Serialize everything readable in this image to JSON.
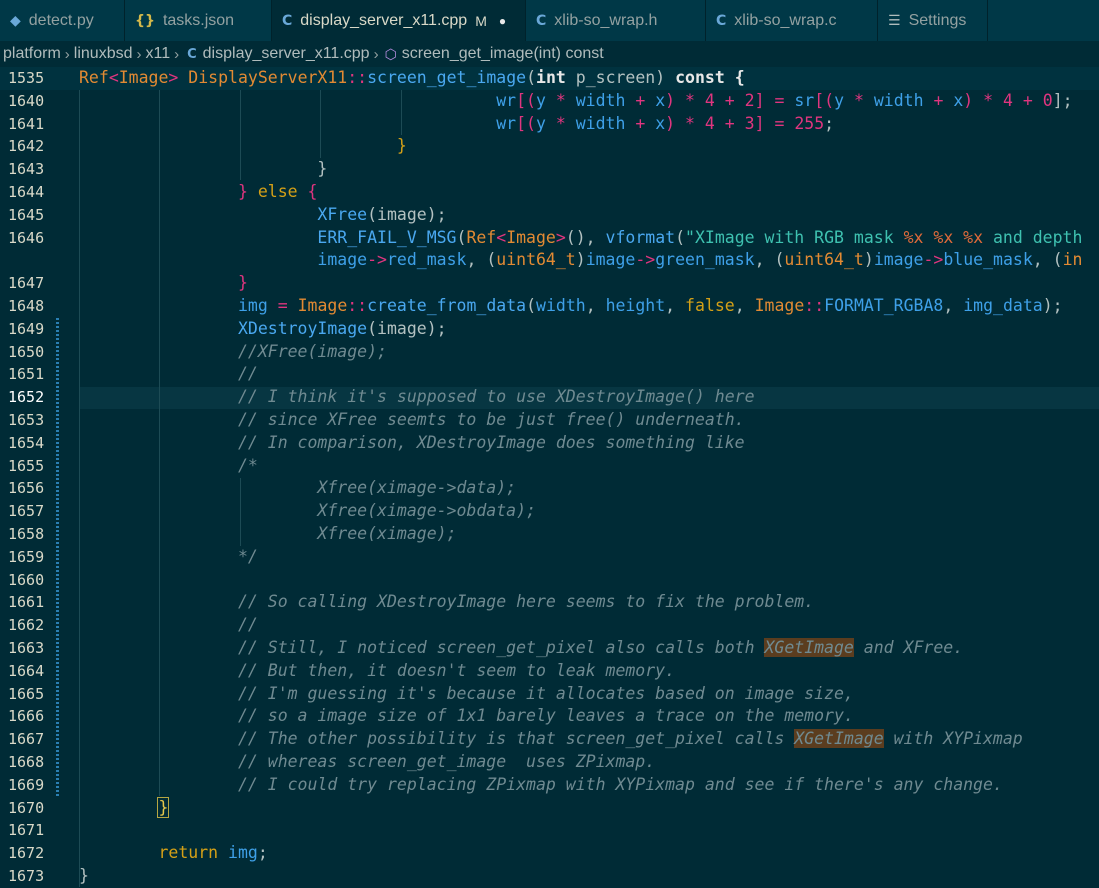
{
  "tabs": [
    {
      "label": "detect.py",
      "icon": "python-icon",
      "mod": "",
      "active": false
    },
    {
      "label": "tasks.json",
      "icon": "json-icon",
      "mod": "",
      "active": false
    },
    {
      "label": "display_server_x11.cpp",
      "icon": "cpp-icon",
      "mod": "M",
      "active": true
    },
    {
      "label": "xlib-so_wrap.h",
      "icon": "c-icon",
      "mod": "",
      "active": false
    },
    {
      "label": "xlib-so_wrap.c",
      "icon": "c-icon",
      "mod": "",
      "active": false
    },
    {
      "label": "Settings",
      "icon": "settings-icon",
      "mod": "",
      "active": false
    }
  ],
  "breadcrumb": [
    "platform",
    "linuxbsd",
    "x11",
    "display_server_x11.cpp",
    "screen_get_image(int) const"
  ],
  "colors": {
    "background": "#002b36",
    "comment": "#6f8a91",
    "highlight": "#5b3d1f"
  },
  "lines": [
    {
      "n": "1535",
      "s": [
        [
          "Ref",
          "t-orange"
        ],
        [
          "<",
          "t-pink"
        ],
        [
          "Image",
          "t-orange"
        ],
        [
          "> ",
          "t-pink"
        ],
        [
          "DisplayServerX11",
          "t-orange"
        ],
        [
          "::",
          "t-pink"
        ],
        [
          "screen_get_image",
          "t-fn"
        ],
        [
          "(",
          "t-plain"
        ],
        [
          "int",
          "t-white"
        ],
        [
          " p_screen) ",
          "t-plain"
        ],
        [
          "const",
          "t-white"
        ],
        [
          " {",
          "t-white"
        ]
      ]
    },
    {
      "n": "1640",
      "s": [
        [
          "                                          ",
          ""
        ],
        [
          "wr",
          "t-blue"
        ],
        [
          "[(",
          "t-pink"
        ],
        [
          "y",
          "t-blue"
        ],
        [
          " * ",
          "t-pink"
        ],
        [
          "width",
          "t-blue"
        ],
        [
          " + ",
          "t-pink"
        ],
        [
          "x",
          "t-blue"
        ],
        [
          ") * ",
          "t-pink"
        ],
        [
          "4",
          "t-pink"
        ],
        [
          " + ",
          "t-pink"
        ],
        [
          "2",
          "t-pink"
        ],
        [
          "] = ",
          "t-pink"
        ],
        [
          "sr",
          "t-blue"
        ],
        [
          "[(",
          "t-pink"
        ],
        [
          "y",
          "t-blue"
        ],
        [
          " * ",
          "t-pink"
        ],
        [
          "width",
          "t-blue"
        ],
        [
          " + ",
          "t-pink"
        ],
        [
          "x",
          "t-blue"
        ],
        [
          ") * ",
          "t-pink"
        ],
        [
          "4",
          "t-pink"
        ],
        [
          " + ",
          "t-pink"
        ],
        [
          "0",
          "t-pink"
        ],
        [
          "];",
          "t-plain"
        ]
      ]
    },
    {
      "n": "1641",
      "s": [
        [
          "                                          ",
          ""
        ],
        [
          "wr",
          "t-blue"
        ],
        [
          "[(",
          "t-pink"
        ],
        [
          "y",
          "t-blue"
        ],
        [
          " * ",
          "t-pink"
        ],
        [
          "width",
          "t-blue"
        ],
        [
          " + ",
          "t-pink"
        ],
        [
          "x",
          "t-blue"
        ],
        [
          ") * ",
          "t-pink"
        ],
        [
          "4",
          "t-pink"
        ],
        [
          " + ",
          "t-pink"
        ],
        [
          "3",
          "t-pink"
        ],
        [
          "] = ",
          "t-pink"
        ],
        [
          "255",
          "t-pink"
        ],
        [
          ";",
          "t-plain"
        ]
      ]
    },
    {
      "n": "1642",
      "s": [
        [
          "                                ",
          ""
        ],
        [
          "}",
          "t-yellow"
        ]
      ]
    },
    {
      "n": "1643",
      "s": [
        [
          "                        ",
          ""
        ],
        [
          "}",
          "t-plain"
        ]
      ]
    },
    {
      "n": "1644",
      "s": [
        [
          "                ",
          ""
        ],
        [
          "}",
          "t-pink"
        ],
        [
          " else ",
          "t-yellow"
        ],
        [
          "{",
          "t-pink"
        ]
      ]
    },
    {
      "n": "1645",
      "s": [
        [
          "                        ",
          ""
        ],
        [
          "XFree",
          "t-fn"
        ],
        [
          "(image);",
          "t-plain"
        ]
      ]
    },
    {
      "n": "1646",
      "s": [
        [
          "                        ",
          ""
        ],
        [
          "ERR_FAIL_V_MSG",
          "t-fn"
        ],
        [
          "(",
          "t-plain"
        ],
        [
          "Ref",
          "t-orange"
        ],
        [
          "<",
          "t-pink"
        ],
        [
          "Image",
          "t-orange"
        ],
        [
          ">",
          "t-pink"
        ],
        [
          "(), ",
          "t-plain"
        ],
        [
          "vformat",
          "t-fn"
        ],
        [
          "(",
          "t-plain"
        ],
        [
          "\"XImage with RGB mask ",
          "t-str"
        ],
        [
          "%x %x %x",
          "t-fmt"
        ],
        [
          " and depth",
          "t-str"
        ]
      ]
    },
    {
      "n": "",
      "s": [
        [
          "                        ",
          ""
        ],
        [
          "image",
          "t-blue"
        ],
        [
          "->",
          "t-pink"
        ],
        [
          "red_mask",
          "t-blue"
        ],
        [
          ", ",
          "t-plain"
        ],
        [
          "(",
          "t-plain"
        ],
        [
          "uint64_t",
          "t-orange"
        ],
        [
          ")",
          "t-plain"
        ],
        [
          "image",
          "t-blue"
        ],
        [
          "->",
          "t-pink"
        ],
        [
          "green_mask",
          "t-blue"
        ],
        [
          ", ",
          "t-plain"
        ],
        [
          "(",
          "t-plain"
        ],
        [
          "uint64_t",
          "t-orange"
        ],
        [
          ")",
          "t-plain"
        ],
        [
          "image",
          "t-blue"
        ],
        [
          "->",
          "t-pink"
        ],
        [
          "blue_mask",
          "t-blue"
        ],
        [
          ", (",
          "t-plain"
        ],
        [
          "in",
          "t-orange"
        ]
      ]
    },
    {
      "n": "1647",
      "s": [
        [
          "                ",
          ""
        ],
        [
          "}",
          "t-pink"
        ]
      ]
    },
    {
      "n": "1648",
      "s": [
        [
          "                ",
          ""
        ],
        [
          "img",
          "t-blue"
        ],
        [
          " = ",
          "t-pink"
        ],
        [
          "Image",
          "t-orange"
        ],
        [
          "::",
          "t-pink"
        ],
        [
          "create_from_data",
          "t-fn"
        ],
        [
          "(",
          "t-plain"
        ],
        [
          "width",
          "t-blue"
        ],
        [
          ", ",
          "t-plain"
        ],
        [
          "height",
          "t-blue"
        ],
        [
          ", ",
          "t-plain"
        ],
        [
          "false",
          "t-yellow"
        ],
        [
          ", ",
          "t-plain"
        ],
        [
          "Image",
          "t-orange"
        ],
        [
          "::",
          "t-pink"
        ],
        [
          "FORMAT_RGBA8",
          "t-blue"
        ],
        [
          ", ",
          "t-plain"
        ],
        [
          "img_data",
          "t-blue"
        ],
        [
          ");",
          "t-plain"
        ]
      ]
    },
    {
      "n": "1649",
      "s": [
        [
          "                ",
          ""
        ],
        [
          "XDestroyImage",
          "t-fn"
        ],
        [
          "(image);",
          "t-plain"
        ]
      ]
    },
    {
      "n": "1650",
      "s": [
        [
          "                ",
          ""
        ],
        [
          "//XFree(image);",
          "t-com"
        ]
      ]
    },
    {
      "n": "1651",
      "s": [
        [
          "                ",
          ""
        ],
        [
          "//",
          "t-com"
        ]
      ]
    },
    {
      "n": "1652",
      "s": [
        [
          "                ",
          ""
        ],
        [
          "// I think it's supposed to use XDestroyImage() here",
          "t-com"
        ]
      ]
    },
    {
      "n": "1653",
      "s": [
        [
          "                ",
          ""
        ],
        [
          "// since XFree seemts to be just free() underneath.",
          "t-com"
        ]
      ]
    },
    {
      "n": "1654",
      "s": [
        [
          "                ",
          ""
        ],
        [
          "// In comparison, XDestroyImage does something like",
          "t-com"
        ]
      ]
    },
    {
      "n": "1655",
      "s": [
        [
          "                ",
          ""
        ],
        [
          "/*",
          "t-com"
        ]
      ]
    },
    {
      "n": "1656",
      "s": [
        [
          "                        ",
          ""
        ],
        [
          "Xfree(ximage->data);",
          "t-com"
        ]
      ]
    },
    {
      "n": "1657",
      "s": [
        [
          "                        ",
          ""
        ],
        [
          "Xfree(ximage->obdata);",
          "t-com"
        ]
      ]
    },
    {
      "n": "1658",
      "s": [
        [
          "                        ",
          ""
        ],
        [
          "Xfree(ximage);",
          "t-com"
        ]
      ]
    },
    {
      "n": "1659",
      "s": [
        [
          "                ",
          ""
        ],
        [
          "*/",
          "t-com"
        ]
      ]
    },
    {
      "n": "1660",
      "s": []
    },
    {
      "n": "1661",
      "s": [
        [
          "                ",
          ""
        ],
        [
          "// So calling XDestroyImage here seems to fix the problem.",
          "t-com"
        ]
      ]
    },
    {
      "n": "1662",
      "s": [
        [
          "                ",
          ""
        ],
        [
          "//",
          "t-com"
        ]
      ]
    },
    {
      "n": "1663",
      "s": [
        [
          "                ",
          ""
        ],
        [
          "// Still, I noticed screen_get_pixel also calls both ",
          "t-com"
        ],
        [
          "XGetImage",
          "t-com hl"
        ],
        [
          " and XFree.",
          "t-com"
        ]
      ]
    },
    {
      "n": "1664",
      "s": [
        [
          "                ",
          ""
        ],
        [
          "// But then, it doesn't seem to leak memory.",
          "t-com"
        ]
      ]
    },
    {
      "n": "1665",
      "s": [
        [
          "                ",
          ""
        ],
        [
          "// I'm guessing it's because it allocates based on image size,",
          "t-com"
        ]
      ]
    },
    {
      "n": "1666",
      "s": [
        [
          "                ",
          ""
        ],
        [
          "// so a image size of 1x1 barely leaves a trace on the memory.",
          "t-com"
        ]
      ]
    },
    {
      "n": "1667",
      "s": [
        [
          "                ",
          ""
        ],
        [
          "// The other possibility is that screen_get_pixel calls ",
          "t-com"
        ],
        [
          "XGetImage",
          "t-com hl"
        ],
        [
          " with XYPixmap",
          "t-com"
        ]
      ]
    },
    {
      "n": "1668",
      "s": [
        [
          "                ",
          ""
        ],
        [
          "// whereas screen_get_image  uses ZPixmap.",
          "t-com"
        ]
      ]
    },
    {
      "n": "1669",
      "s": [
        [
          "                ",
          ""
        ],
        [
          "// I could try replacing ZPixmap with XYPixmap and see if there's any change.",
          "t-com"
        ]
      ]
    },
    {
      "n": "1670",
      "s": [
        [
          "        ",
          ""
        ],
        [
          "}",
          "t-yellow brk"
        ]
      ]
    },
    {
      "n": "1671",
      "s": []
    },
    {
      "n": "1672",
      "s": [
        [
          "        ",
          ""
        ],
        [
          "return",
          "t-yellow"
        ],
        [
          " ",
          "t-plain"
        ],
        [
          "img",
          "t-blue"
        ],
        [
          ";",
          "t-plain"
        ]
      ]
    },
    {
      "n": "1673",
      "s": [
        [
          "}",
          "t-plain"
        ]
      ]
    }
  ]
}
